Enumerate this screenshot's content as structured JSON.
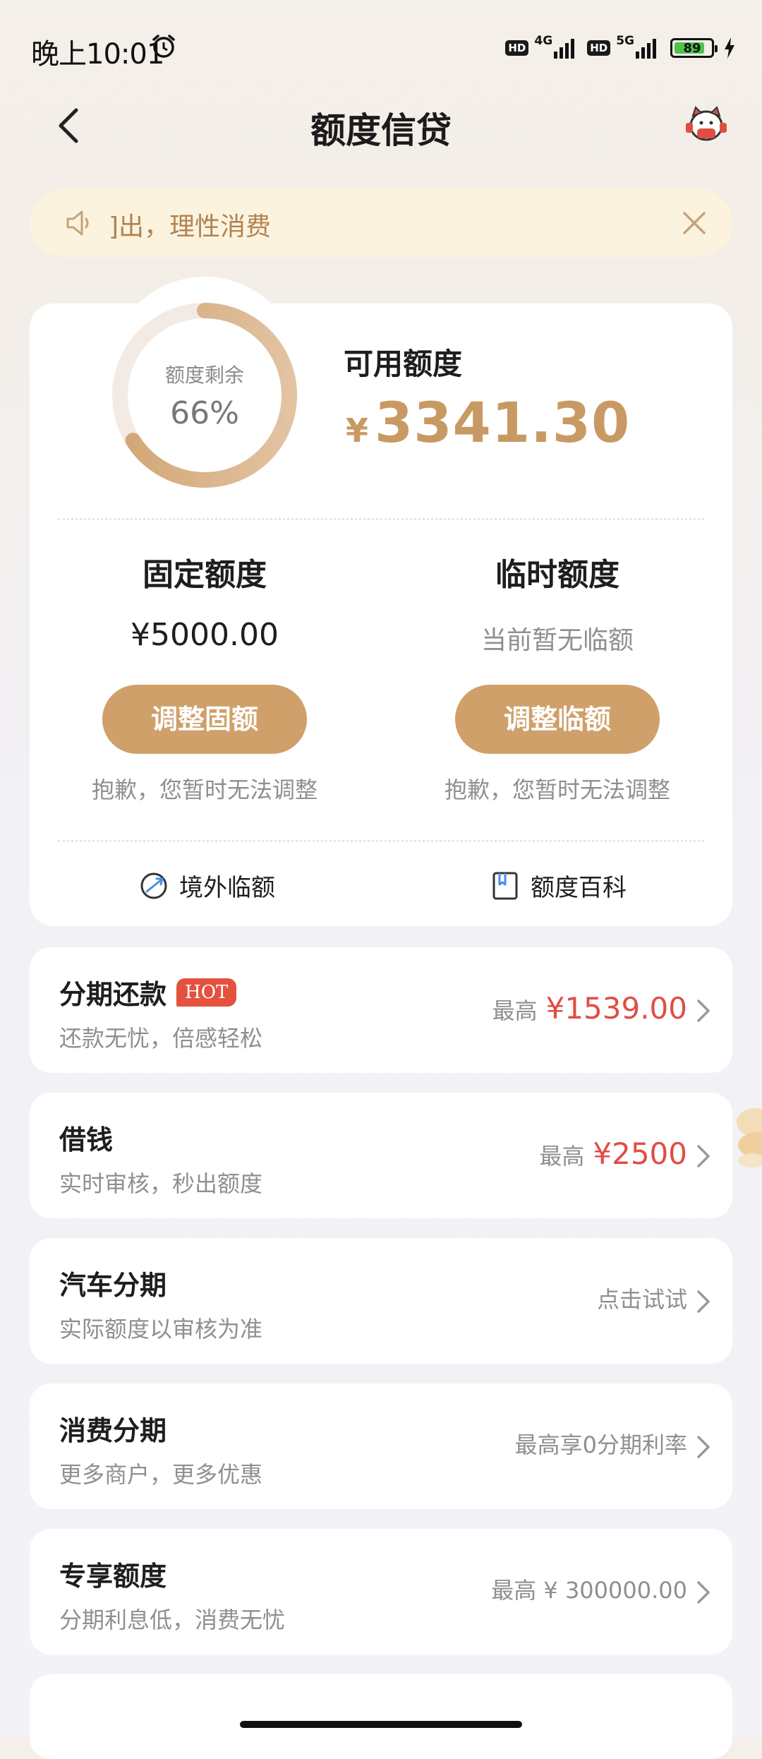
{
  "status_bar": {
    "time": "晚上10:01",
    "hd1": "HD",
    "net1": "4G",
    "hd2": "HD",
    "net2": "5G",
    "battery": "89"
  },
  "header": {
    "title": "额度信贷"
  },
  "notice": {
    "text": "]出，理性消费"
  },
  "credit": {
    "ring_label": "额度剩余",
    "ring_percent": "66%",
    "ring_fraction": 0.66,
    "available_label": "可用额度",
    "available_currency": "¥",
    "available_amount": "3341.30",
    "fixed": {
      "title": "固定额度",
      "value": "¥5000.00",
      "button": "调整固额",
      "note": "抱歉，您暂时无法调整"
    },
    "temporary": {
      "title": "临时额度",
      "value": "当前暂无临额",
      "button": "调整临额",
      "note": "抱歉，您暂时无法调整"
    },
    "links": {
      "overseas": "境外临额",
      "wiki": "额度百科"
    }
  },
  "rows": [
    {
      "title": "分期还款",
      "badge": "HOT",
      "subtitle": "还款无忧，倍感轻松",
      "prefix": "最高",
      "amount": "¥1539.00"
    },
    {
      "title": "借钱",
      "subtitle": "实时审核，秒出额度",
      "prefix": "最高",
      "amount": "¥2500"
    },
    {
      "title": "汽车分期",
      "subtitle": "实际额度以审核为准",
      "right_text": "点击试试"
    },
    {
      "title": "消费分期",
      "subtitle": "更多商户，更多优惠",
      "right_text": "最高享0分期利率"
    },
    {
      "title": "专享额度",
      "subtitle": "分期利息低，消费无忧",
      "right_text": "最高 ¥ 300000.00"
    }
  ],
  "colors": {
    "accent_gold": "#cfa06a",
    "amount_red": "#e04d45",
    "notice_bg": "#fcf3df"
  }
}
